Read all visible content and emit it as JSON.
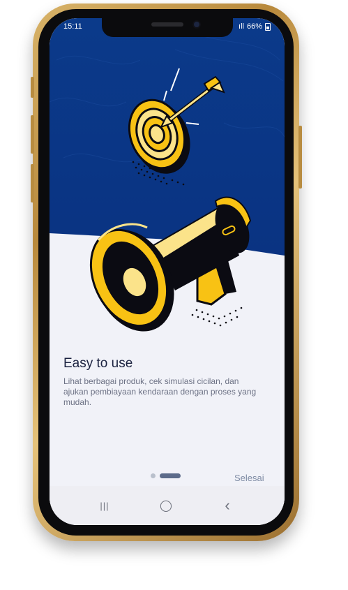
{
  "status_bar": {
    "time": "15:11",
    "signal_text": "ıll",
    "battery": "66%"
  },
  "onboarding": {
    "title": "Easy to use",
    "description": "Lihat berbagai produk, cek simulasi cicilan, dan ajukan pembiayaan kendaraan dengan proses yang mudah.",
    "finish_label": "Selesai",
    "page_count": 2,
    "active_page": 2
  },
  "nav_bar": {
    "recents_icon": "|||",
    "home_icon": "◯",
    "back_icon": "‹"
  },
  "colors": {
    "hero_blue": "#0a3a8c",
    "background": "#f1f2f8",
    "accent_yellow": "#f8c214",
    "frame_gold": "#c49a4c"
  },
  "icons": [
    "target-icon",
    "arrow-icon",
    "megaphone-icon",
    "battery-icon",
    "recents-icon",
    "home-icon",
    "back-icon"
  ]
}
